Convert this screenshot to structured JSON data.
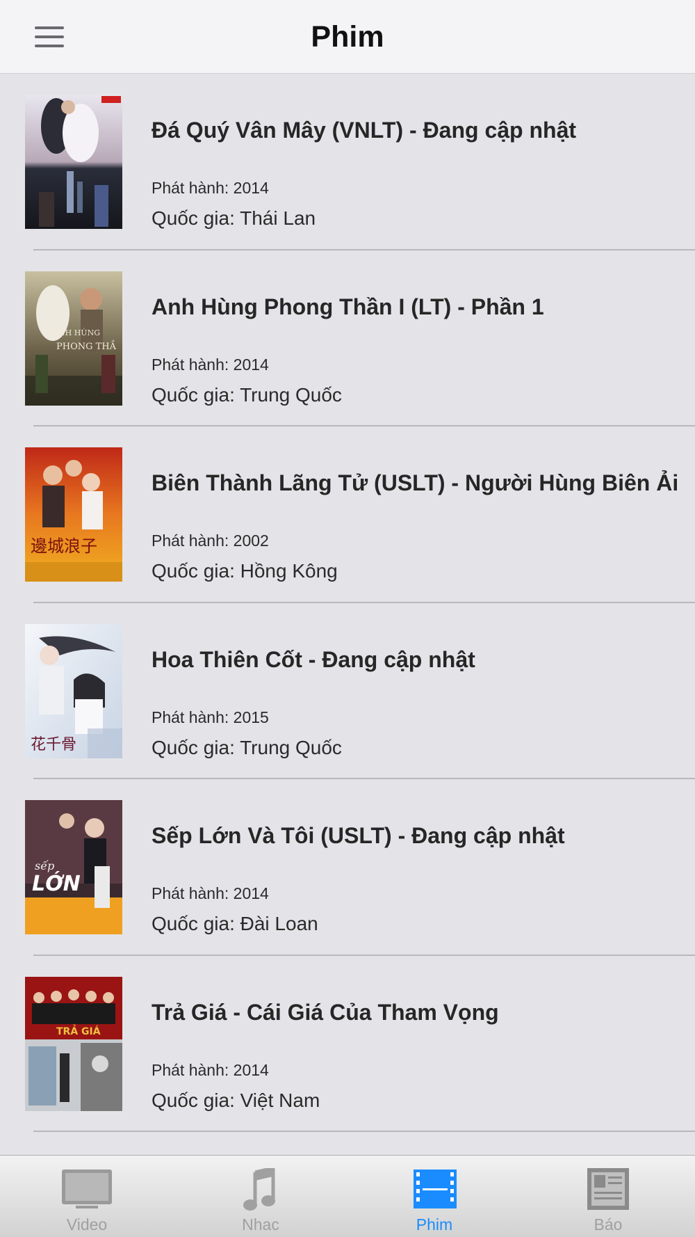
{
  "navbar": {
    "title": "Phim",
    "menu_icon": "hamburger-menu-icon"
  },
  "movies": [
    {
      "title": "Đá Quý Vân Mây (VNLT) - Đang cập nhật",
      "release": "Phát hành: 2014",
      "country": "Quốc gia: Thái Lan"
    },
    {
      "title": "Anh Hùng Phong Thần I (LT) - Phần 1",
      "release": "Phát hành: 2014",
      "country": "Quốc gia: Trung Quốc"
    },
    {
      "title": "Biên Thành Lãng Tử (USLT) - Người Hùng Biên Ải",
      "release": "Phát hành: 2002",
      "country": "Quốc gia: Hồng Kông"
    },
    {
      "title": "Hoa Thiên Cốt - Đang cập nhật",
      "release": "Phát hành: 2015",
      "country": "Quốc gia: Trung Quốc"
    },
    {
      "title": "Sếp Lớn Và Tôi (USLT) - Đang cập nhật",
      "release": "Phát hành: 2014",
      "country": "Quốc gia: Đài Loan"
    },
    {
      "title": "Trả Giá - Cái Giá Của Tham Vọng",
      "release": "Phát hành: 2014",
      "country": "Quốc gia: Việt Nam"
    }
  ],
  "tabs": [
    {
      "label": "Video",
      "icon": "tv-icon",
      "active": false
    },
    {
      "label": "Nhac",
      "icon": "music-note-icon",
      "active": false
    },
    {
      "label": "Phim",
      "icon": "film-strip-icon",
      "active": true
    },
    {
      "label": "Báo",
      "icon": "newspaper-icon",
      "active": false
    }
  ],
  "colors": {
    "accent": "#1a8cff",
    "inactive_tab": "#a0a0a0",
    "background": "#e4e4e8"
  }
}
